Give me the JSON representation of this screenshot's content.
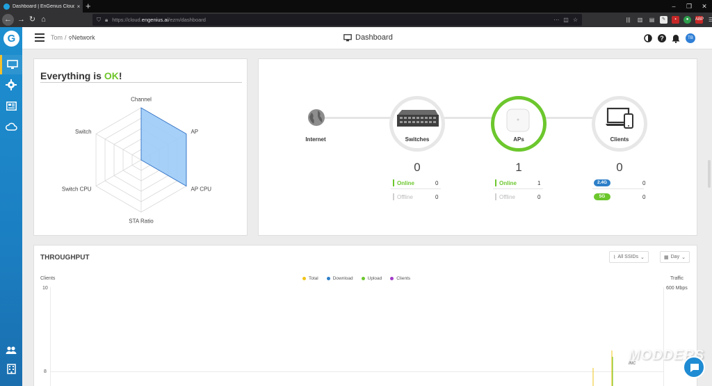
{
  "browser": {
    "tab_title": "Dashboard | EnGenius Cloud",
    "tab_close": "×",
    "new_tab": "+",
    "url_prefix": "https://cloud.",
    "url_domain": "engenius.ai",
    "url_path": "/ezm/dashboard",
    "url_more": "···",
    "win_min": "–",
    "win_max": "❐",
    "win_close": "✕",
    "ext_abp": "ABP"
  },
  "header": {
    "breadcrumb_user": "Tom",
    "breadcrumb_sep": "/",
    "breadcrumb_network": "Network",
    "title": "Dashboard",
    "avatar_initials": "TB"
  },
  "status": {
    "title_prefix": "Everything is ",
    "title_ok": "OK",
    "title_suffix": "!",
    "radar": {
      "axes": [
        "Channel",
        "AP",
        "AP CPU",
        "STA Ratio",
        "Switch CPU",
        "Switch"
      ],
      "values": [
        1,
        1,
        1,
        0,
        0,
        0
      ],
      "fill_color": "#9ccbf7",
      "stroke_color": "#3a78c9"
    }
  },
  "topology": {
    "internet_label": "Internet",
    "nodes": [
      {
        "label": "Switches",
        "count": "0",
        "online_label": "Online",
        "online": "0",
        "offline_label": "Offline",
        "offline": "0"
      },
      {
        "label": "APs",
        "count": "1",
        "online_label": "Online",
        "online": "1",
        "offline_label": "Offline",
        "offline": "0"
      },
      {
        "label": "Clients",
        "count": "0",
        "band1_label": "2.4G",
        "band1": "0",
        "band2_label": "5G",
        "band2": "0"
      }
    ],
    "colors": {
      "online": "#6cc72d",
      "offline": "#cfcfcf",
      "band24": "#2d7fc8",
      "band5": "#6cc72d"
    }
  },
  "throughput": {
    "title": "THROUGHPUT",
    "ssid_dropdown": "All SSIDs",
    "range_dropdown": "Day",
    "left_axis_label": "Clients",
    "right_axis_label": "Traffic",
    "left_top_tick": "10",
    "left_second_tick": "8",
    "right_top_tick": "600 Mbps",
    "legend": [
      {
        "label": "Total",
        "color": "#f0c419"
      },
      {
        "label": "Download",
        "color": "#2d7fc8"
      },
      {
        "label": "Upload",
        "color": "#6cc72d"
      },
      {
        "label": "Clients",
        "color": "#a23bc8"
      }
    ]
  },
  "watermark": {
    "line1": "MODDERS",
    "line2": "INC"
  }
}
